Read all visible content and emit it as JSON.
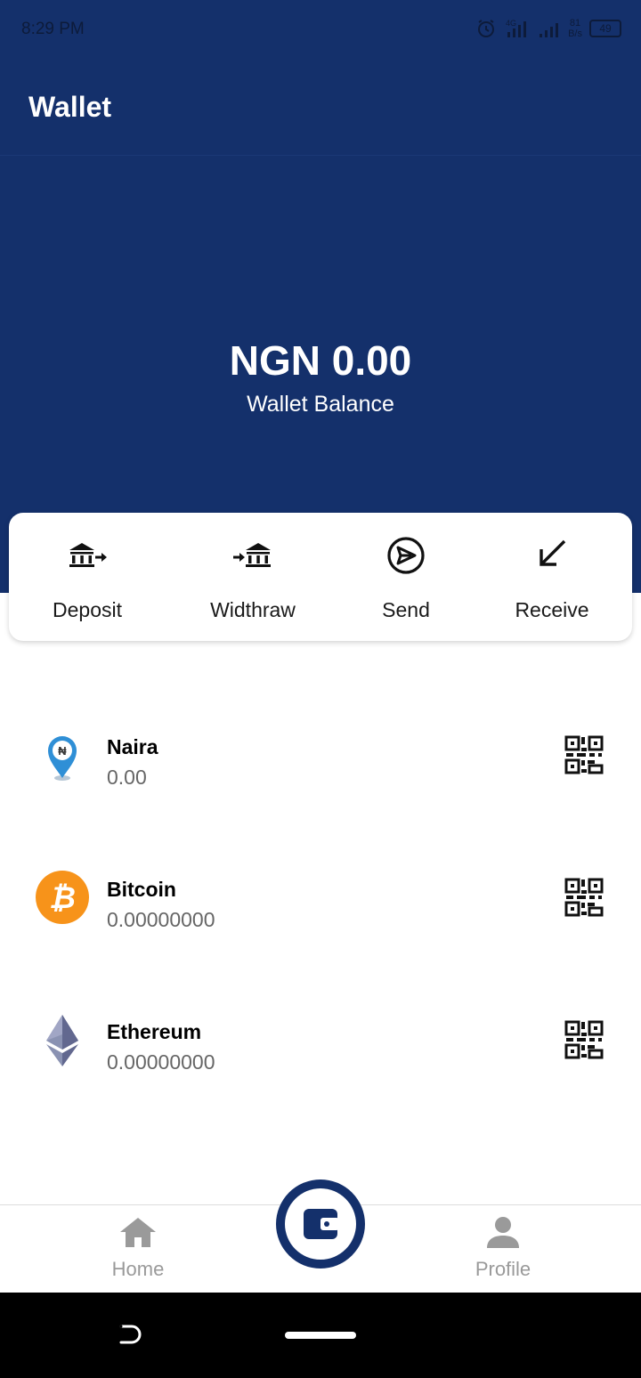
{
  "status_bar": {
    "time": "8:29 PM",
    "network": "4G",
    "speed_value": "81",
    "speed_unit": "B/s",
    "battery": "49"
  },
  "header": {
    "title": "Wallet"
  },
  "balance": {
    "amount": "NGN 0.00",
    "label": "Wallet Balance"
  },
  "actions": [
    {
      "label": "Deposit",
      "icon": "bank-deposit-icon"
    },
    {
      "label": "Widthraw",
      "icon": "bank-withdraw-icon"
    },
    {
      "label": "Send",
      "icon": "send-icon"
    },
    {
      "label": "Receive",
      "icon": "receive-arrow-icon"
    }
  ],
  "assets": [
    {
      "name": "Naira",
      "balance": "0.00",
      "icon": "naira-pin-icon"
    },
    {
      "name": "Bitcoin",
      "balance": "0.00000000",
      "icon": "bitcoin-icon"
    },
    {
      "name": "Ethereum",
      "balance": "0.00000000",
      "icon": "ethereum-icon"
    }
  ],
  "bottom_nav": {
    "home_label": "Home",
    "profile_label": "Profile"
  },
  "colors": {
    "primary": "#14306b",
    "bitcoin": "#f7931a",
    "ethereum": "#627eea",
    "nav_inactive": "#9a9a9a"
  }
}
